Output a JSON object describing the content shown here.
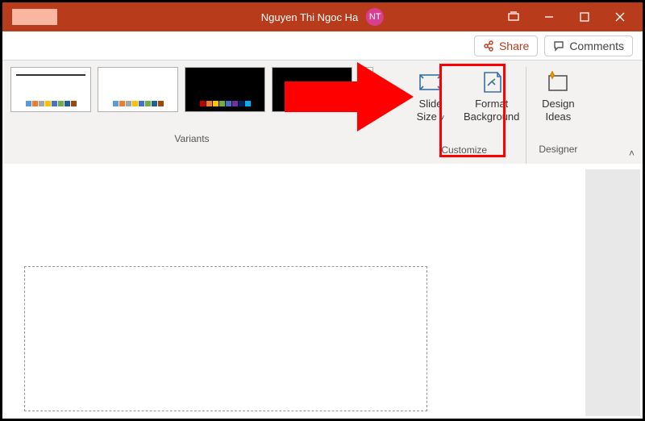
{
  "titlebar": {
    "user_name": "Nguyen Thi Ngoc Ha",
    "avatar_initials": "NT"
  },
  "sharebar": {
    "share_label": "Share",
    "comments_label": "Comments"
  },
  "ribbon": {
    "variants_label": "Variants",
    "customize_label": "Customize",
    "designer_label": "Designer",
    "slide_size_label_1": "Slide",
    "slide_size_label_2": "Size",
    "format_bg_label_1": "Format",
    "format_bg_label_2": "Background",
    "design_ideas_label_1": "Design",
    "design_ideas_label_2": "Ideas"
  },
  "variant_colors": {
    "set1": [
      "#5b9bd5",
      "#ed7d31",
      "#a5a5a5",
      "#ffc000",
      "#4472c4",
      "#70ad47",
      "#255e91",
      "#9e480e"
    ],
    "set2": [
      "#5b9bd5",
      "#ed7d31",
      "#a5a5a5",
      "#ffc000",
      "#4472c4",
      "#70ad47",
      "#255e91",
      "#9e480e"
    ],
    "set3": [
      "#c00000",
      "#ed7d31",
      "#ffc000",
      "#70ad47",
      "#4472c4",
      "#7030a0",
      "#002060",
      "#00b0f0"
    ],
    "set4": [
      "#c00000",
      "#ed7d31",
      "#ffc000",
      "#70ad47",
      "#4472c4",
      "#7030a0",
      "#ff33cc",
      "#00b0f0"
    ]
  }
}
